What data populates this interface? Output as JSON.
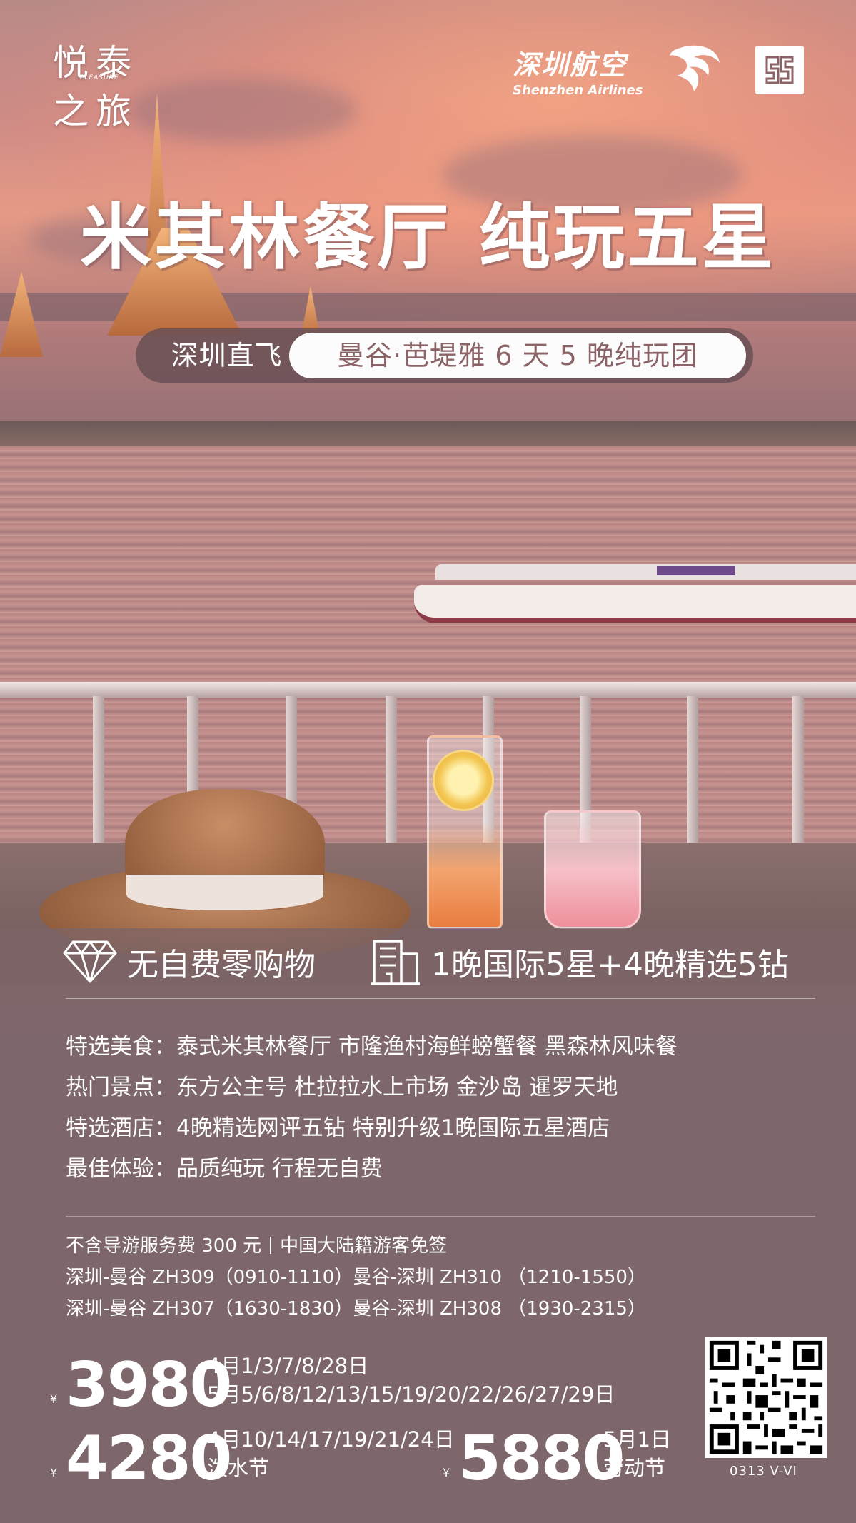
{
  "brand": {
    "char1": "悦",
    "char2": "泰",
    "char3": "之",
    "char4": "旅",
    "sub": "PLEASURE"
  },
  "airline": {
    "name_cn": "深圳航空",
    "name_en": "Shenzhen Airlines"
  },
  "partner_logo_text": "SJS",
  "headline": "米其林餐厅 纯玩五星",
  "route": {
    "left": "深圳直飞",
    "right": "曼谷·芭堤雅 6 天 5 晚纯玩团"
  },
  "highlights": {
    "no_shopping": "无自费零购物",
    "hotel": "1晚国际5星+4晚精选5钻"
  },
  "features": [
    {
      "label": "特选美食：",
      "value": "泰式米其林餐厅  市隆渔村海鲜螃蟹餐  黑森林风味餐"
    },
    {
      "label": "热门景点：",
      "value": "东方公主号  杜拉拉水上市场  金沙岛  暹罗天地"
    },
    {
      "label": "特选酒店：",
      "value": "4晚精选网评五钻  特别升级1晚国际五星酒店"
    },
    {
      "label": "最佳体验：",
      "value": "品质纯玩  行程无自费"
    }
  ],
  "notes": {
    "fee": "不含导游服务费 300 元",
    "visa": "中国大陆籍游客免签",
    "flight1": "深圳-曼谷 ZH309（0910-1110）曼谷-深圳  ZH310 （1210-1550）",
    "flight2": "深圳-曼谷 ZH307（1630-1830）曼谷-深圳  ZH308 （1930-2315）"
  },
  "prices": [
    {
      "currency": "¥",
      "amount": "3980",
      "line1": "4月1/3/7/8/28日",
      "line2": "5月5/6/8/12/13/15/19/20/22/26/27/29日"
    },
    {
      "currency": "¥",
      "amount": "4280",
      "line1": "4月10/14/17/19/21/24日",
      "line2": "泼水节"
    },
    {
      "currency": "¥",
      "amount": "5880",
      "line1": "5月1日",
      "line2": "劳动节"
    }
  ],
  "qr_caption": "0313 V-VI",
  "colors": {
    "route_text": "#8b6366",
    "panel": "#7e676b"
  }
}
